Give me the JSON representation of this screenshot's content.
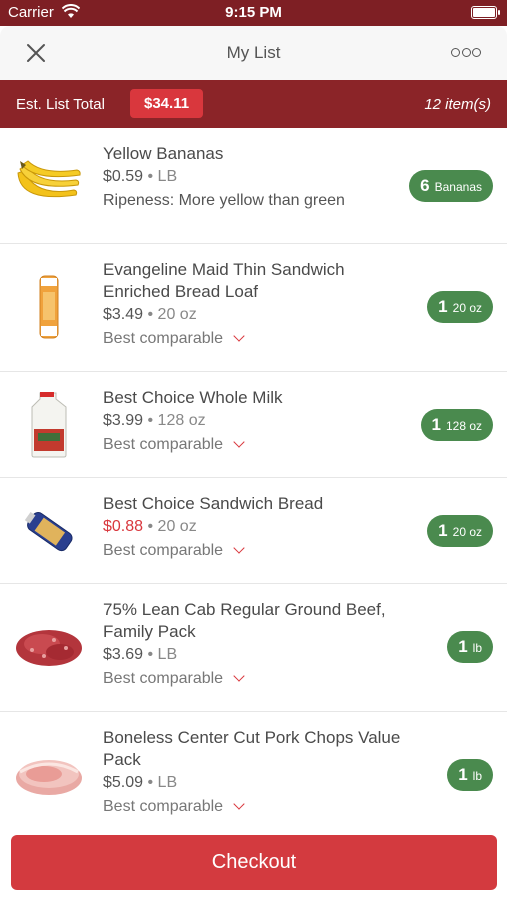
{
  "status_bar": {
    "carrier": "Carrier",
    "time": "9:15 PM"
  },
  "nav": {
    "title": "My List"
  },
  "summary": {
    "label": "Est. List Total",
    "total": "$34.11",
    "count": "12 item(s)"
  },
  "items": [
    {
      "name": "Yellow Bananas",
      "price": "$0.59",
      "unit": "LB",
      "note": "Ripeness: More yellow than green",
      "option": "",
      "qty": "6",
      "qty_unit": "Bananas",
      "image": "bananas-image"
    },
    {
      "name": "Evangeline Maid Thin Sandwich Enriched Bread Loaf",
      "price": "$3.49",
      "unit": "20 oz",
      "note": "",
      "option": "Best comparable",
      "qty": "1",
      "qty_unit": "20 oz",
      "image": "bread-loaf-image"
    },
    {
      "name": "Best Choice Whole Milk",
      "price": "$3.99",
      "unit": "128 oz",
      "note": "",
      "option": "Best comparable",
      "qty": "1",
      "qty_unit": "128 oz",
      "image": "milk-jug-image"
    },
    {
      "name": "Best Choice Sandwich Bread",
      "price": "$0.88",
      "unit": "20 oz",
      "note": "",
      "option": "Best comparable",
      "qty": "1",
      "qty_unit": "20 oz",
      "image": "sandwich-bread-image"
    },
    {
      "name": "75% Lean Cab Regular Ground Beef, Family Pack",
      "price": "$3.69",
      "unit": "LB",
      "note": "",
      "option": "Best comparable",
      "qty": "1",
      "qty_unit": "lb",
      "image": "ground-beef-image"
    },
    {
      "name": "Boneless Center Cut Pork Chops Value Pack",
      "price": "$5.09",
      "unit": "LB",
      "note": "",
      "option": "Best comparable",
      "qty": "1",
      "qty_unit": "lb",
      "image": "pork-chops-image"
    }
  ],
  "checkout": {
    "label": "Checkout"
  },
  "colors": {
    "brand_dark": "#8b2428",
    "accent_red": "#d9373d",
    "qty_green": "#4a8a4e",
    "sale_price": "#d9373d"
  },
  "icons": {
    "close": "close-icon",
    "more": "more-icon",
    "chevron": "chevron-down-icon",
    "wifi": "wifi-icon",
    "battery": "battery-icon"
  }
}
